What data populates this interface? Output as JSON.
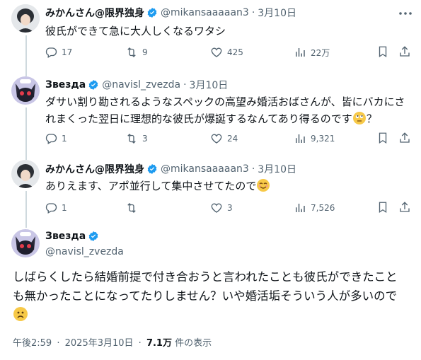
{
  "tweets": [
    {
      "name": "みかんさん@限界独身",
      "handle": "@mikansaaaaan3",
      "sep": "·",
      "date": "3月10日",
      "text": "彼氏ができて急に大人しくなるワタシ",
      "stats": {
        "replies": "17",
        "retweets": "9",
        "likes": "425",
        "views": "22万"
      }
    },
    {
      "name": "Звезда",
      "handle": "@navisl_zvezda",
      "sep": "·",
      "date": "3月10日",
      "text_line1": "ダサい割り勘されるようなスペックの高望み婚活おばさんが、皆にバカにさ",
      "text_line2a": "れまくった翌日に理想的な彼氏が爆誕するなんてあり得るのです",
      "text_line2b": "？",
      "stats": {
        "replies": "1",
        "retweets": "3",
        "likes": "24",
        "views": "9,321"
      }
    },
    {
      "name": "みかんさん@限界独身",
      "handle": "@mikansaaaaan3",
      "sep": "·",
      "date": "3月10日",
      "text": "ありえます、アポ並行して集中させてたので",
      "stats": {
        "replies": "1",
        "retweets": "",
        "likes": "3",
        "views": "7,526"
      }
    }
  ],
  "main_tweet": {
    "name": "Звезда",
    "handle": "@navisl_zvezda",
    "text_line1": "しばらくしたら結婚前提で付き合おうと言われたことも彼氏ができたこと",
    "text_line2": "も無かったことになってたりしません？いや婚活垢そういう人が多いので",
    "time": "午後2:59",
    "dot": "·",
    "date": "2025年3月10日",
    "views_count": "7.1万",
    "views_label": "件の表示"
  },
  "colors": {
    "verified": "#1d9bf0",
    "muted": "#536471",
    "thread_line": "#cfd9de"
  },
  "icons": [
    "reply-icon",
    "retweet-icon",
    "like-icon",
    "views-icon",
    "bookmark-icon",
    "share-icon",
    "more-icon",
    "verified-badge-icon"
  ]
}
